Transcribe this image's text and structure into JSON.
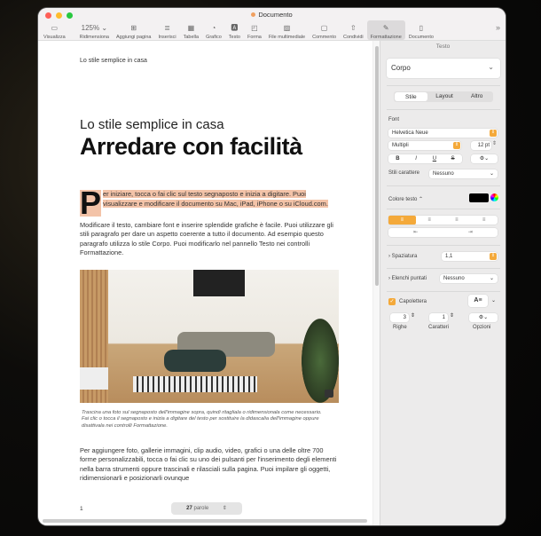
{
  "window": {
    "title": "Documento"
  },
  "toolbar": [
    {
      "label": "Visualizza",
      "icon": "sidebar-icon",
      "glyph": "▭"
    },
    {
      "label": "Ridimensiona",
      "icon": "zoom-icon",
      "glyph": "125% ⌄"
    },
    {
      "label": "Aggiungi pagina",
      "icon": "add-page-icon",
      "glyph": "⊞"
    },
    {
      "label": "Inserisci",
      "icon": "insert-icon",
      "glyph": "≣"
    },
    {
      "label": "Tabella",
      "icon": "table-icon",
      "glyph": "▦"
    },
    {
      "label": "Grafico",
      "icon": "chart-icon",
      "glyph": "◔"
    },
    {
      "label": "Testo",
      "icon": "text-icon",
      "glyph": "🅰"
    },
    {
      "label": "Forma",
      "icon": "shape-icon",
      "glyph": "◰"
    },
    {
      "label": "File multimediale",
      "icon": "media-icon",
      "glyph": "▨"
    },
    {
      "label": "Commento",
      "icon": "comment-icon",
      "glyph": "▢"
    },
    {
      "label": "Condividi",
      "icon": "share-icon",
      "glyph": "⇧"
    },
    {
      "label": "Formattazione",
      "icon": "format-icon",
      "glyph": "✎"
    },
    {
      "label": "Documento",
      "icon": "document-icon",
      "glyph": "▯"
    }
  ],
  "document": {
    "header": "Lo stile semplice in casa",
    "subtitle": "Lo stile semplice in casa",
    "title": "Arredare con facilità",
    "dropcap": "P",
    "para1": "er iniziare, tocca o fai clic sul testo segnaposto e inizia a digitare. Puoi visualizzare e modificare il documento su Mac, iPad, iPhone o su iCloud.com.",
    "para2": "Modificare il testo, cambiare font e inserire splendide grafiche è facile. Puoi utilizzare gli stili paragrafo per dare un aspetto coerente a tutto il documento. Ad esempio questo paragrafo utilizza lo stile Corpo. Puoi modificarlo nel pannello Testo nei controlli Formattazione.",
    "caption1": "Trascina una foto sul segnaposto dell'immagine sopra, quindi ritagliala o ridimensionala come necessario.",
    "caption2": "Fai clic o tocca il segnaposto e inizia a digitare del testo per sostituire la didascalia dell'immagine oppure disattivala nei controlli Formattazione.",
    "para3": "Per aggiungere foto, gallerie immagini, clip audio, video, grafici o una delle oltre 700 forme personalizzabili, tocca o fai clic su uno dei pulsanti per l'inserimento degli elementi nella barra strumenti oppure trascinali e rilasciali sulla pagina. Puoi impilare gli oggetti, ridimensionarli e posizionarli ovunque",
    "page_number": "1",
    "word_count": "27",
    "word_label": "parole"
  },
  "sidebar": {
    "title": "Testo",
    "style": "Corpo",
    "tabs": [
      "Stile",
      "Layout",
      "Altro"
    ],
    "font_label": "Font",
    "font": "Helvetica Neue",
    "typeface": "Multipli",
    "size": "12 pt",
    "format_buttons": [
      "B",
      "I",
      "U",
      "S"
    ],
    "char_styles_label": "Stili carattere",
    "char_style": "Nessuno",
    "color_label": "Colore testo ⌃",
    "text_color": "#000000",
    "spacing_label": "Spaziatura",
    "spacing": "1,1",
    "bullets_label": "Elenchi puntati",
    "bullets": "Nessuno",
    "dropcap_label": "Capolettera",
    "dropcap_checked": true,
    "lines": "3",
    "chars": "1",
    "lines_label": "Righe",
    "chars_label": "Caratteri",
    "options_label": "Opzioni"
  }
}
